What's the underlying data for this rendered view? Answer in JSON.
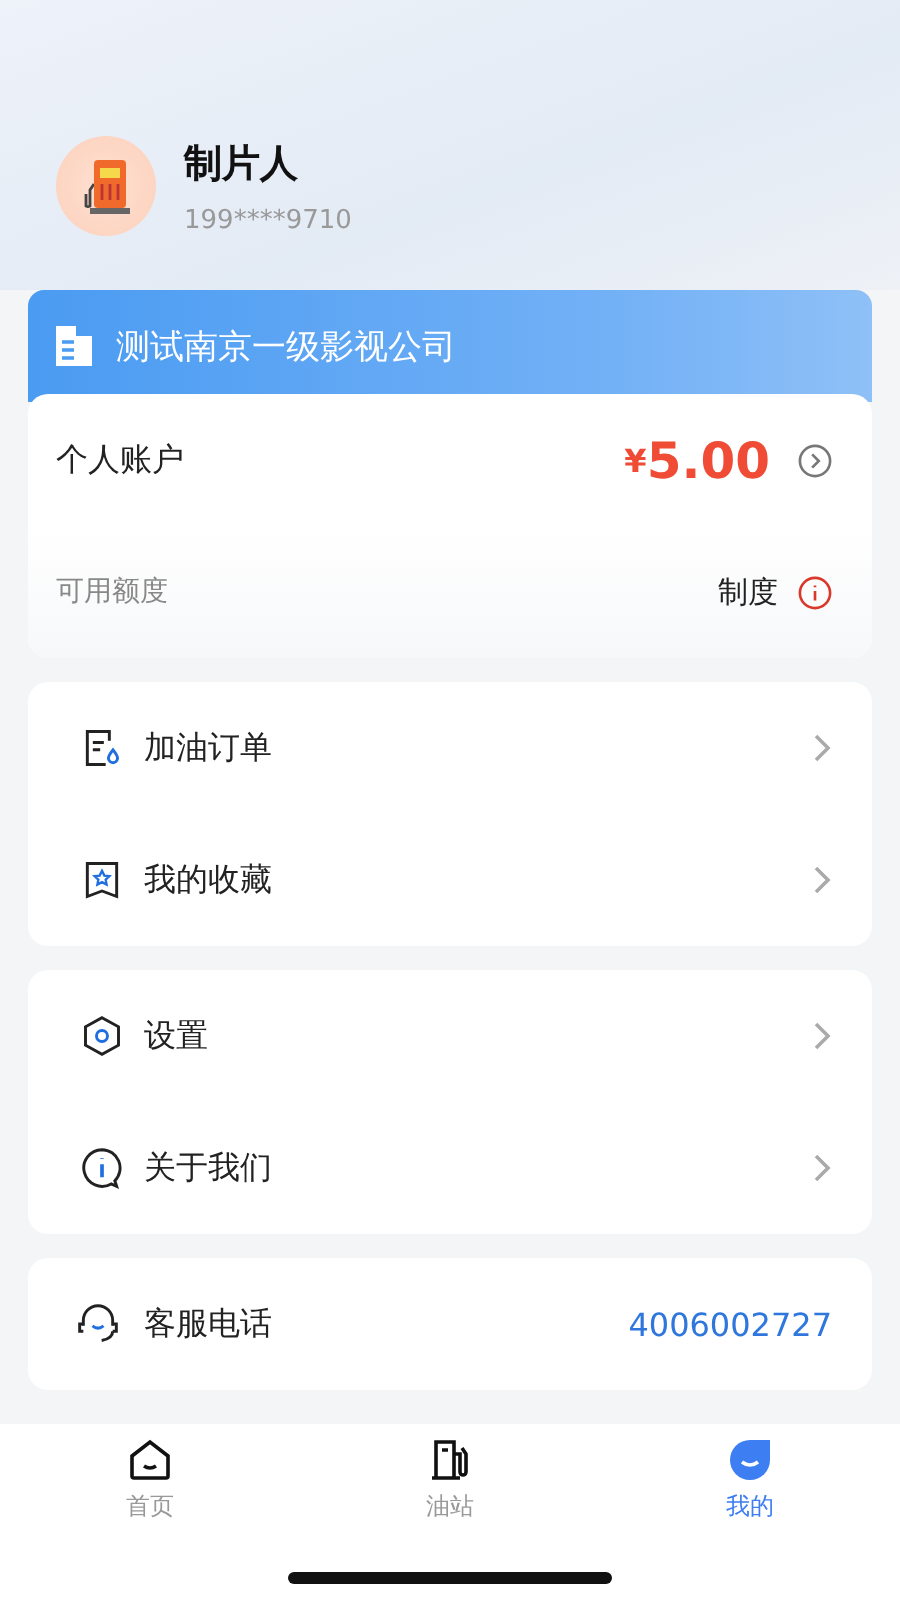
{
  "profile": {
    "name": "制片人",
    "phone": "199****9710"
  },
  "company": {
    "name": "测试南京一级影视公司"
  },
  "account": {
    "label": "个人账户",
    "currency": "¥",
    "amount": "5.00"
  },
  "credit": {
    "label": "可用额度",
    "value": "制度"
  },
  "menu_groups": [
    [
      {
        "kind": "orders",
        "label": "加油订单"
      },
      {
        "kind": "favorites",
        "label": "我的收藏"
      }
    ],
    [
      {
        "kind": "settings",
        "label": "设置"
      },
      {
        "kind": "about",
        "label": "关于我们"
      }
    ]
  ],
  "service": {
    "label": "客服电话",
    "phone": "4006002727"
  },
  "tabs": [
    {
      "kind": "home",
      "label": "首页",
      "selected": false
    },
    {
      "kind": "station",
      "label": "油站",
      "selected": false
    },
    {
      "kind": "mine",
      "label": "我的",
      "selected": true
    }
  ]
}
